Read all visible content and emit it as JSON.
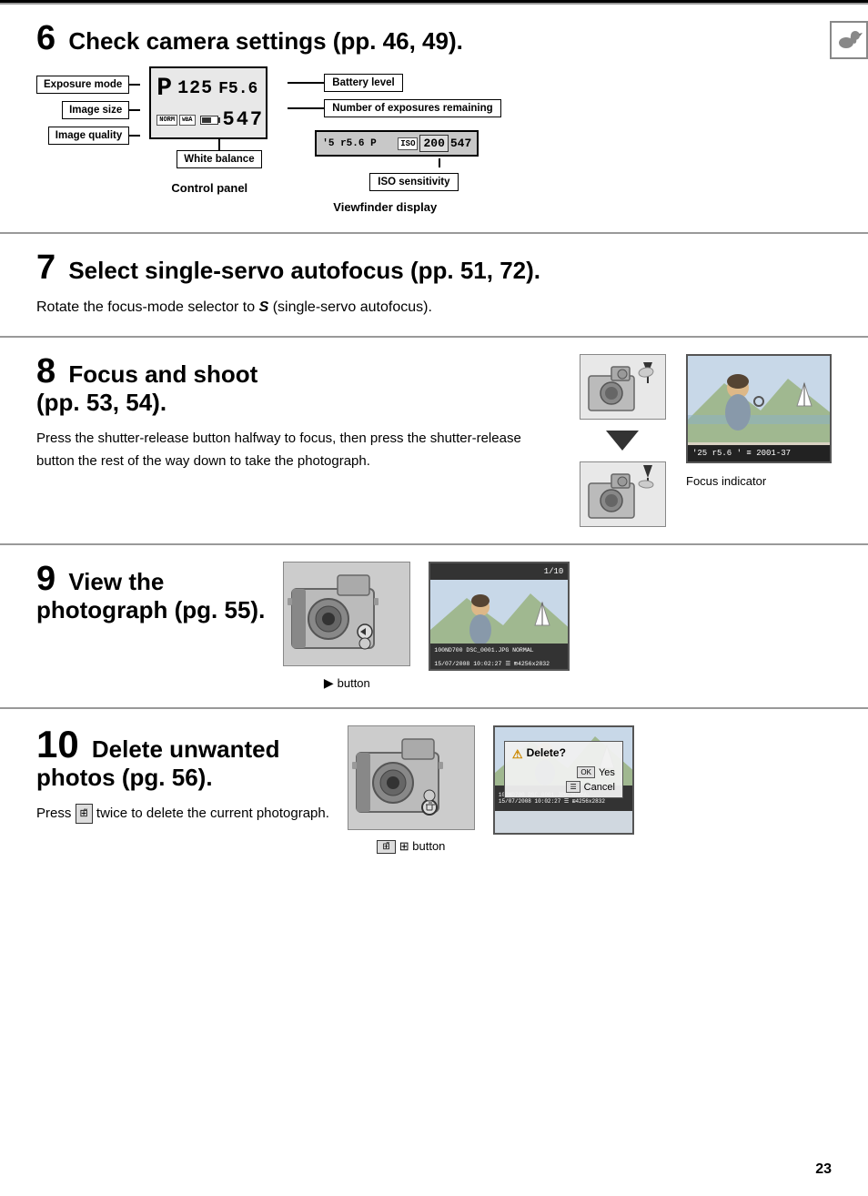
{
  "sections": {
    "s6": {
      "number": "6",
      "title": "Check camera settings (pp. 46, 49).",
      "labels_left": [
        "Exposure mode",
        "Image size",
        "Image quality"
      ],
      "labels_right": [
        "Battery level",
        "Number of exposures remaining"
      ],
      "lcd": {
        "mode": "P",
        "shutter": "125",
        "aperture": "F5.6",
        "number": "547"
      },
      "wb_label": "White balance",
      "iso_label": "ISO sensitivity",
      "viewfinder_text": [
        "'5  r5.6 P",
        "ISO  200 547"
      ],
      "captions": [
        "Control panel",
        "Viewfinder display"
      ]
    },
    "s7": {
      "number": "7",
      "title": "Select single-servo autofocus (pp. 51, 72).",
      "body": "Rotate the focus-mode selector to S (single-servo autofocus)."
    },
    "s8": {
      "number": "8",
      "title": "Focus and shoot\n(pp. 53, 54).",
      "body": "Press the shutter-release button halfway to focus, then press the shutter-release button the rest of the way down to take the photograph.",
      "focus_indicator_label": "Focus indicator",
      "vf_status": "'25  r5.6 '    ≡  2001-37"
    },
    "s9": {
      "number": "9",
      "title": "View the\nphotograph (pg. 55).",
      "button_label": "▶ button",
      "counter": "1/10",
      "footer_text": "100ND700   DSC_0001.JPG       NORMAL\n15/07/2008  10:02:27    ☰ ⊞4256x2832"
    },
    "s10": {
      "number": "10",
      "title": "Delete unwanted\nphotos (pg. 56).",
      "body": "Press  twice to delete the current photograph.",
      "button_label": "⊞ button",
      "delete_dialog": {
        "title": "Delete?",
        "yes": "Yes",
        "cancel": "Cancel"
      },
      "footer_text": "100ND700   DSC_0001.JPG       NORMAL\n15/07/2008  10:02:27    ☰ ⊞4256x2832"
    }
  },
  "page_number": "23"
}
